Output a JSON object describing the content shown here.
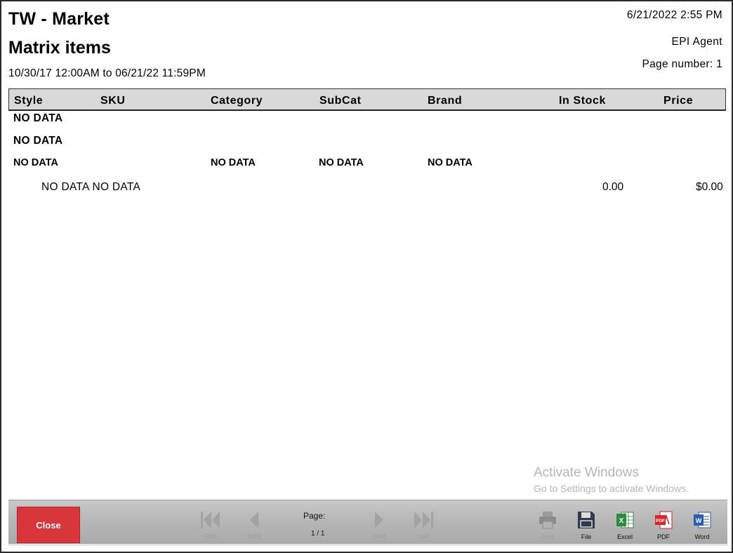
{
  "report": {
    "store_name": "TW - Market",
    "title": "Matrix items",
    "date_range": "10/30/17 12:00AM to 06/21/22 11:59PM",
    "print_date": "6/21/2022 2:55 PM",
    "agent": "EPI Agent",
    "page_number": "Page number: 1"
  },
  "table": {
    "columns": [
      "Style",
      "SKU",
      "Category",
      "SubCat",
      "Brand",
      "In Stock",
      "Price"
    ],
    "group1": "NO DATA",
    "group2": "NO DATA",
    "group3": {
      "style": "NO DATA",
      "category": "NO DATA",
      "subcat": "NO DATA",
      "brand": "NO DATA"
    },
    "item": {
      "desc": "NO DATA NO DATA",
      "in_stock": "0.00",
      "price": "$0.00"
    }
  },
  "watermark": {
    "line1": "Activate Windows",
    "line2": "Go to Settings to activate Windows."
  },
  "toolbar": {
    "close_label": "Close",
    "nav": {
      "first": "First",
      "back": "Back",
      "next": "Next",
      "last": "Last"
    },
    "page_label": "Page:",
    "page_count": "1 / 1",
    "export": {
      "print": "Print",
      "file": "File",
      "excel": "Excel",
      "pdf": "PDF",
      "word": "Word"
    }
  },
  "colors": {
    "close_button": "#d9363b",
    "excel_icon": "#2e8b3e",
    "pdf_icon": "#d6262b",
    "word_icon": "#2b5fb3",
    "file_icon": "#2f3a4a"
  }
}
